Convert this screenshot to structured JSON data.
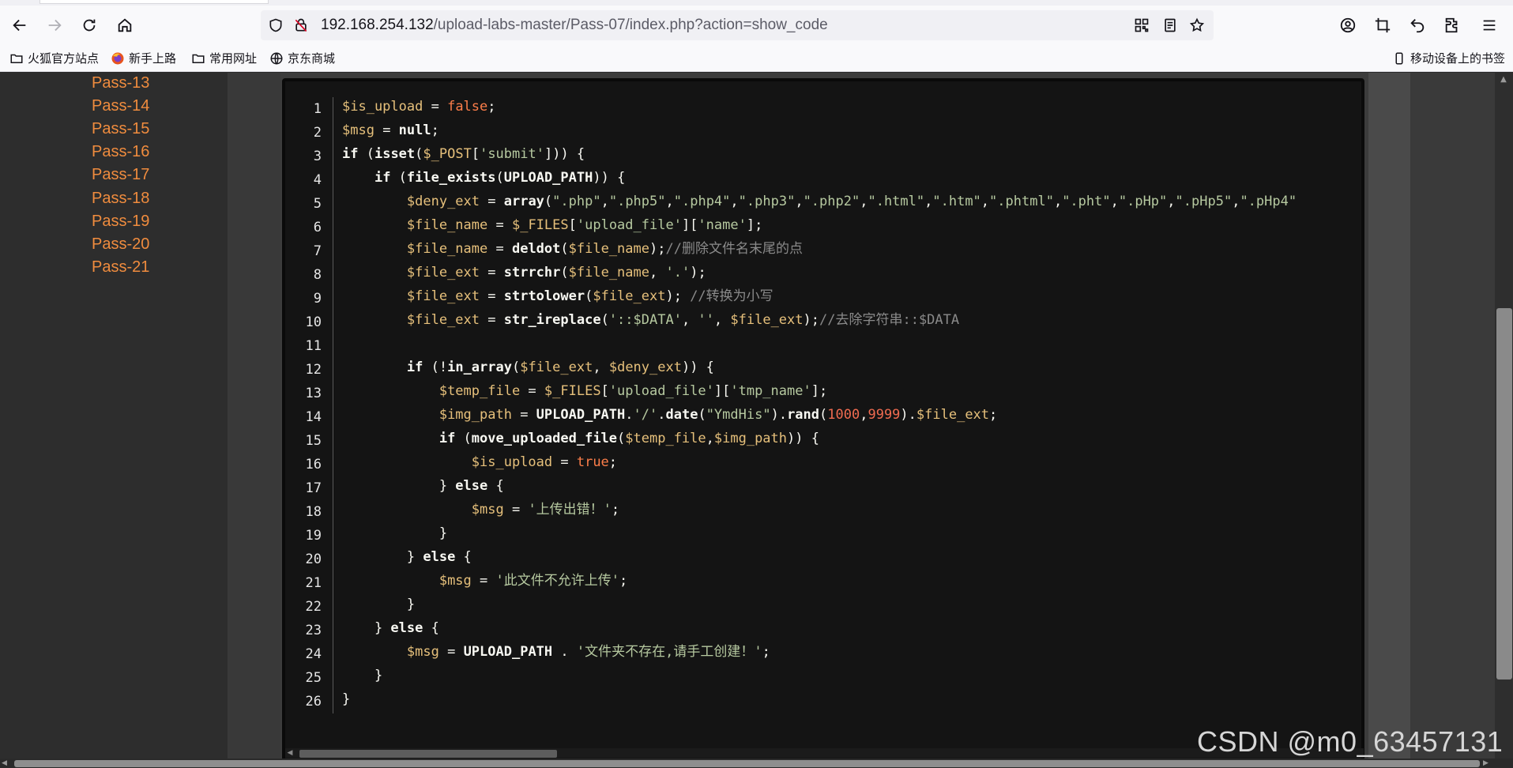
{
  "browser": {
    "url_host": "192.168.254.132",
    "url_path": "/upload-labs-master/Pass-07/index.php?action=show_code"
  },
  "bookmarks": [
    {
      "label": "火狐官方站点",
      "icon": "folder-icon"
    },
    {
      "label": "新手上路",
      "icon": "firefox-icon"
    },
    {
      "label": "常用网址",
      "icon": "folder-icon"
    },
    {
      "label": "京东商城",
      "icon": "globe-icon"
    }
  ],
  "bookmarks_mobile": "移动设备上的书签",
  "sidebar": {
    "items": [
      "Pass-13",
      "Pass-14",
      "Pass-15",
      "Pass-16",
      "Pass-17",
      "Pass-18",
      "Pass-19",
      "Pass-20",
      "Pass-21"
    ],
    "link_color": "#f08c3e"
  },
  "code": {
    "line_numbers": [
      "1",
      "2",
      "3",
      "4",
      "5",
      "6",
      "7",
      "8",
      "9",
      "10",
      "11",
      "12",
      "13",
      "14",
      "15",
      "16",
      "17",
      "18",
      "19",
      "20",
      "21",
      "22",
      "23",
      "24",
      "25",
      "26"
    ],
    "lines": [
      "$is_upload = false;",
      "$msg = null;",
      "if (isset($_POST['submit'])) {",
      "    if (file_exists(UPLOAD_PATH)) {",
      "        $deny_ext = array(\".php\",\".php5\",\".php4\",\".php3\",\".php2\",\".html\",\".htm\",\".phtml\",\".pht\",\".pHp\",\".pHp5\",\".pHp4\"",
      "        $file_name = $_FILES['upload_file']['name'];",
      "        $file_name = deldot($file_name);//删除文件名末尾的点",
      "        $file_ext = strrchr($file_name, '.');",
      "        $file_ext = strtolower($file_ext); //转换为小写",
      "        $file_ext = str_ireplace('::$DATA', '', $file_ext);//去除字符串::$DATA",
      "",
      "        if (!in_array($file_ext, $deny_ext)) {",
      "            $temp_file = $_FILES['upload_file']['tmp_name'];",
      "            $img_path = UPLOAD_PATH.'/'.date(\"YmdHis\").rand(1000,9999).$file_ext;",
      "            if (move_uploaded_file($temp_file,$img_path)) {",
      "                $is_upload = true;",
      "            } else {",
      "                $msg = '上传出错！';",
      "            }",
      "        } else {",
      "            $msg = '此文件不允许上传';",
      "        }",
      "    } else {",
      "        $msg = UPLOAD_PATH . '文件夹不存在,请手工创建！';",
      "    }",
      "}"
    ]
  },
  "watermark": "CSDN @m0_63457131"
}
